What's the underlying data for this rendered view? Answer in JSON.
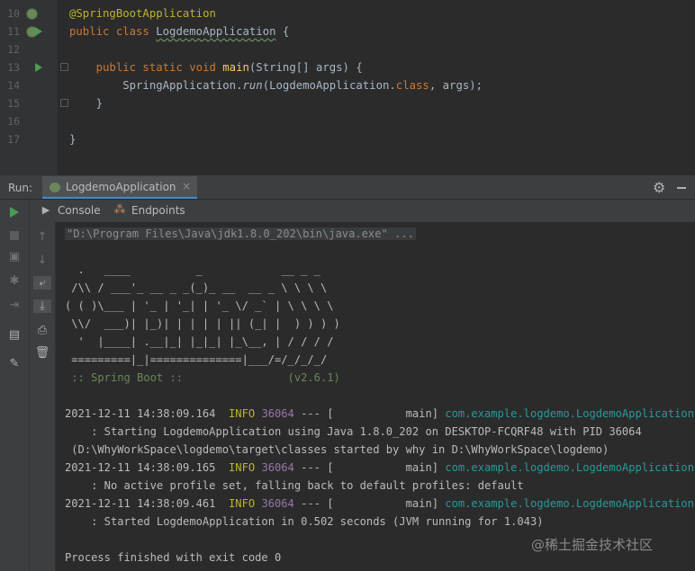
{
  "editor": {
    "lines": [
      {
        "num": "10",
        "parts": [
          {
            "t": "@SpringBootApplication",
            "c": "ann"
          }
        ]
      },
      {
        "num": "11",
        "parts": [
          {
            "t": "public class ",
            "c": "kw"
          },
          {
            "t": "LogdemoApplication",
            "c": "u"
          },
          {
            "t": " {",
            "c": ""
          }
        ]
      },
      {
        "num": "12",
        "parts": []
      },
      {
        "num": "13",
        "parts": [
          {
            "t": "    public static void ",
            "c": "kw"
          },
          {
            "t": "main",
            "c": "fn"
          },
          {
            "t": "(String[] args) {",
            "c": ""
          }
        ]
      },
      {
        "num": "14",
        "parts": [
          {
            "t": "        SpringApplication.",
            "c": ""
          },
          {
            "t": "run",
            "c": "it"
          },
          {
            "t": "(LogdemoApplication.",
            "c": ""
          },
          {
            "t": "class",
            "c": "kw"
          },
          {
            "t": ", args);",
            "c": ""
          }
        ]
      },
      {
        "num": "15",
        "parts": [
          {
            "t": "    }",
            "c": ""
          }
        ]
      },
      {
        "num": "16",
        "parts": []
      },
      {
        "num": "17",
        "parts": [
          {
            "t": "}",
            "c": ""
          }
        ]
      }
    ]
  },
  "run": {
    "label": "Run:",
    "tab_label": "LogdemoApplication",
    "close": "×",
    "settings_icon": "gear-icon",
    "minimize_icon": "minimize-icon"
  },
  "subtabs": {
    "console": "Console",
    "endpoints": "Endpoints"
  },
  "console": {
    "command": "\"D:\\Program Files\\Java\\jdk1.8.0_202\\bin\\java.exe\" ...",
    "banner": [
      "  .   ____          _            __ _ _",
      " /\\\\ / ___'_ __ _ _(_)_ __  __ _ \\ \\ \\ \\",
      "( ( )\\___ | '_ | '_| | '_ \\/ _` | \\ \\ \\ \\",
      " \\\\/  ___)| |_)| | | | | || (_| |  ) ) ) )",
      "  '  |____| .__|_| |_|_| |_\\__, | / / / /",
      " =========|_|==============|___/=/_/_/_/"
    ],
    "spring_boot": " :: Spring Boot ::                (v2.6.1)",
    "logs": [
      {
        "ts": "2021-12-11 14:38:09.164",
        "level": "INFO",
        "pid": "36064",
        "mid": " --- [           main] ",
        "cls": "com.example.logdemo.LogdemoApplication",
        "msg": [
          "    : Starting LogdemoApplication using Java 1.8.0_202 on DESKTOP-FCQRF48 with PID 36064",
          " (D:\\WhyWorkSpace\\logdemo\\target\\classes started by why in D:\\WhyWorkSpace\\logdemo)"
        ]
      },
      {
        "ts": "2021-12-11 14:38:09.165",
        "level": "INFO",
        "pid": "36064",
        "mid": " --- [           main] ",
        "cls": "com.example.logdemo.LogdemoApplication",
        "msg": [
          "    : No active profile set, falling back to default profiles: default"
        ]
      },
      {
        "ts": "2021-12-11 14:38:09.461",
        "level": "INFO",
        "pid": "36064",
        "mid": " --- [           main] ",
        "cls": "com.example.logdemo.LogdemoApplication",
        "msg": [
          "    : Started LogdemoApplication in 0.502 seconds (JVM running for 1.043)"
        ]
      }
    ],
    "exit": "Process finished with exit code 0"
  },
  "watermark": "@稀土掘金技术社区",
  "colors": {
    "accent": "#4a88c7",
    "run_green": "#499c54",
    "info": "#bbb529",
    "class": "#299999"
  }
}
